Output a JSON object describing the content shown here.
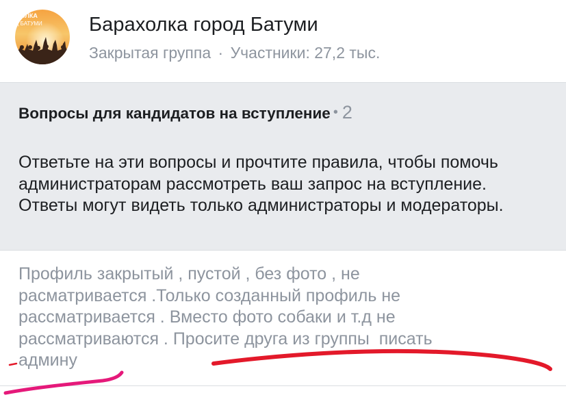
{
  "header": {
    "group_name": "Барахолка город Батуми",
    "privacy": "Закрытая группа",
    "separator": "·",
    "members": "Участники: 27,2 тыс.",
    "avatar_text_line1": "ХОЛКА",
    "avatar_text_line2": "Д БАТУМИ"
  },
  "questions_intro": {
    "title": "Вопросы для кандидатов на вступление",
    "bullet": "•",
    "count": "2",
    "description": "Ответьте на эти вопросы и прочтите правила, чтобы помочь администраторам рассмотреть ваш запрос на вступление. Ответы могут видеть только администраторы и модераторы."
  },
  "question": {
    "lines": [
      "Профиль закрытый , пустой , без фото , не",
      "расматривается .Только созданный профиль не",
      "рассматривается .  Вместо фото собаки и т.д не",
      "рассматриваются . Просите друга из группы  писать",
      "админу"
    ]
  },
  "colors": {
    "text_primary": "#1c1e21",
    "text_secondary": "#8d949e",
    "panel_background": "#e9ebee",
    "annotation_red": "#e3192a",
    "annotation_pink": "#e5197a"
  },
  "icons": {
    "avatar": "group-avatar-sunset-people"
  }
}
